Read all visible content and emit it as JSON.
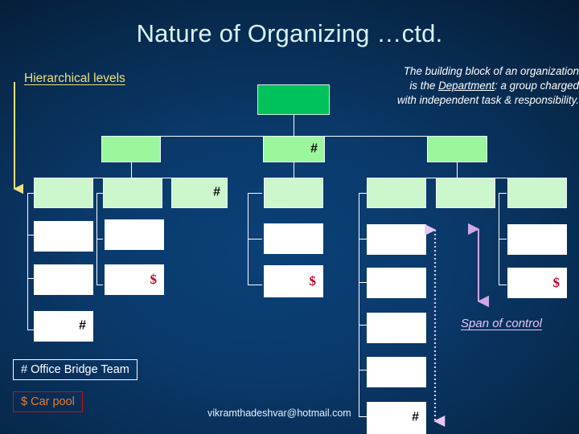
{
  "slide": {
    "title": "Nature of Organizing …ctd.",
    "hierarchical_label": "Hierarchical levels",
    "span_of_control_label": "Span of control",
    "email": "vikramthadeshvar@hotmail.com",
    "background_color": "#0a3a6c",
    "title_color": "#d9f2f7",
    "accent_yellow": "#efe07a",
    "accent_violet": "#e7c5f7"
  },
  "description": {
    "line1": "The building block of an organization",
    "line2_before": "is the ",
    "line2_underlined": "Department",
    "line2_after": ": a group charged",
    "line3": "with independent task & responsibility."
  },
  "legend": {
    "office_bridge_team": "# Office Bridge Team",
    "car_pool": "$ Car pool",
    "office_border_color": "#ffffff",
    "office_text_color": "#ffffff",
    "carpool_border_color": "#b81515",
    "carpool_text_color": "#ef7b2e"
  },
  "markers": {
    "hash": "#",
    "dollar": "$"
  },
  "chart_data": {
    "type": "diagram",
    "title": "Nature of Organizing …ctd.",
    "diagram_kind": "organization-chart",
    "root": {
      "label": "",
      "fill": "#00c25c"
    },
    "branches": [
      {
        "name": "left-branch",
        "head": {
          "fill": "#9bf79b",
          "mark": ""
        },
        "columns": [
          {
            "nodes": [
              {
                "fill": "#ccf7cc",
                "mark": ""
              },
              {
                "fill": "#ffffff",
                "mark": ""
              },
              {
                "fill": "#ffffff",
                "mark": ""
              },
              {
                "fill": "#ffffff",
                "mark": "#"
              }
            ]
          },
          {
            "nodes": [
              {
                "fill": "#ccf7cc",
                "mark": ""
              },
              {
                "fill": "#ffffff",
                "mark": ""
              },
              {
                "fill": "#ffffff",
                "mark": "$"
              }
            ]
          },
          {
            "nodes": [
              {
                "fill": "#ccf7cc",
                "mark": "#"
              }
            ]
          }
        ]
      },
      {
        "name": "middle-branch",
        "head": {
          "fill": "#9bf79b",
          "mark": "#"
        },
        "columns": [
          {
            "nodes": [
              {
                "fill": "#ccf7cc",
                "mark": ""
              },
              {
                "fill": "#ffffff",
                "mark": ""
              },
              {
                "fill": "#ffffff",
                "mark": "$"
              }
            ]
          }
        ]
      },
      {
        "name": "right-branch",
        "head": {
          "fill": "#9bf79b",
          "mark": ""
        },
        "columns": [
          {
            "nodes": [
              {
                "fill": "#ccf7cc",
                "mark": ""
              },
              {
                "fill": "#ffffff",
                "mark": ""
              },
              {
                "fill": "#ffffff",
                "mark": ""
              },
              {
                "fill": "#ffffff",
                "mark": ""
              },
              {
                "fill": "#ffffff",
                "mark": ""
              },
              {
                "fill": "#ffffff",
                "mark": "#"
              }
            ]
          },
          {
            "nodes": [
              {
                "fill": "#ccf7cc",
                "mark": ""
              }
            ]
          },
          {
            "nodes": [
              {
                "fill": "#ccf7cc",
                "mark": ""
              },
              {
                "fill": "#ffffff",
                "mark": ""
              },
              {
                "fill": "#ffffff",
                "mark": "$"
              }
            ]
          }
        ]
      }
    ],
    "annotations": [
      {
        "name": "hierarchical-levels-arrow",
        "direction": "down",
        "color": "#efe07a",
        "style": "solid"
      },
      {
        "name": "span-of-control-dotted-arrow",
        "direction": "both",
        "color": "#e7c5f7",
        "style": "dotted"
      },
      {
        "name": "span-of-control-solid-arrow",
        "direction": "both",
        "color": "#cfa8e8",
        "style": "solid"
      }
    ]
  }
}
